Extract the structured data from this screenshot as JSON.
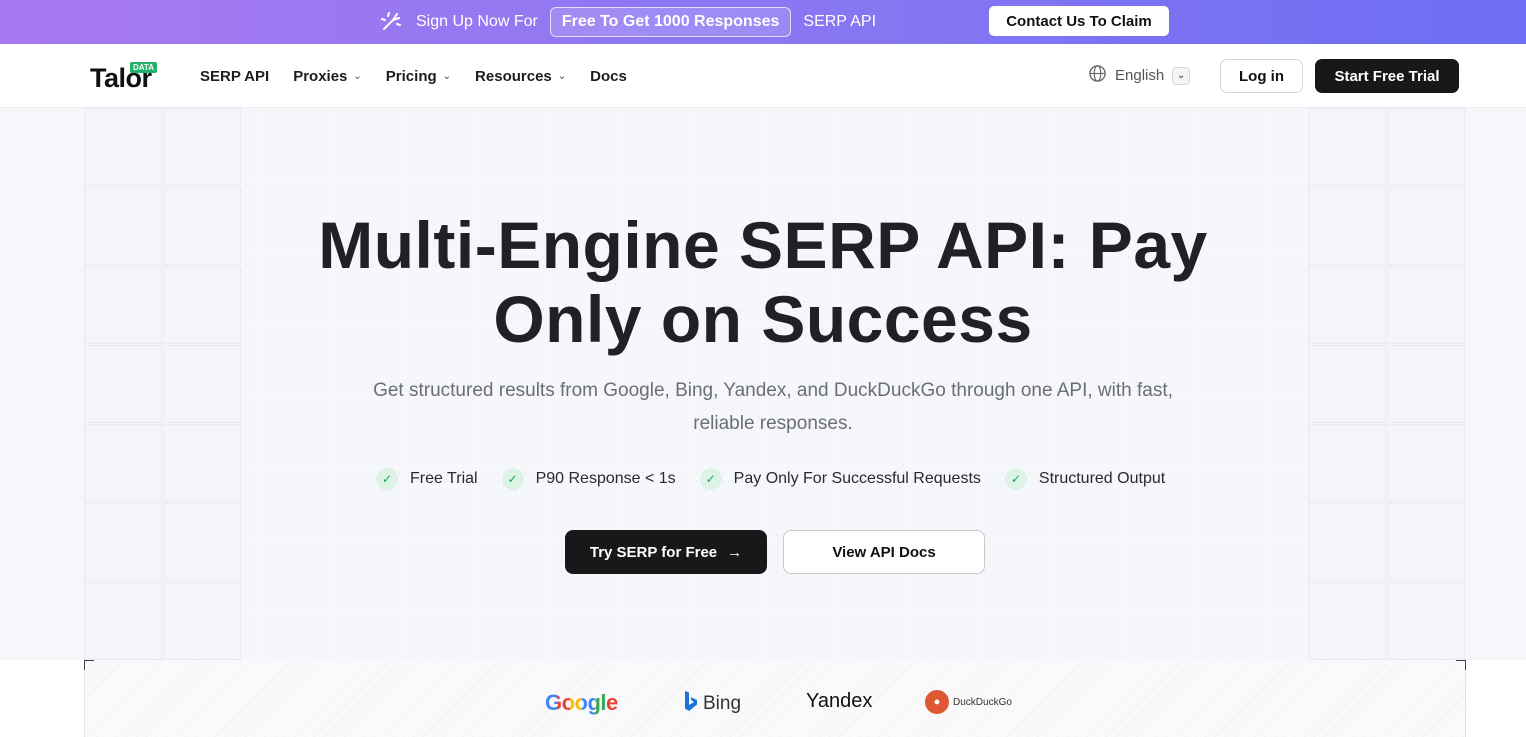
{
  "promo": {
    "lead": "Sign Up Now For",
    "pill": "Free To Get 1000 Responses",
    "product": "SERP API",
    "cta": "Contact Us To Claim"
  },
  "nav": {
    "logo": "Talor",
    "logo_badge": "DATA",
    "links": [
      {
        "label": "SERP API"
      },
      {
        "label": "Proxies"
      },
      {
        "label": "Pricing"
      },
      {
        "label": "Resources"
      },
      {
        "label": "Docs"
      }
    ],
    "language": "English",
    "login": "Log in",
    "start_trial": "Start Free Trial"
  },
  "hero": {
    "title_line1": "Multi-Engine SERP API: Pay",
    "title_line2": "Only on Success",
    "subtitle_line1": "Get structured results from Google, Bing, Yandex, and DuckDuckGo through one API, with fast,",
    "subtitle_line2": "reliable responses.",
    "features": [
      "Free Trial",
      "P90 Response < 1s",
      "Pay Only For Successful Requests",
      "Structured Output"
    ],
    "primary_cta": "Try SERP for Free",
    "secondary_cta": "View API Docs"
  },
  "engines": {
    "google": "Google",
    "bing": "Bing",
    "yandex": "Yandex",
    "duckduckgo": "DuckDuckGo"
  },
  "colors": {
    "promo_start": "#a979f0",
    "promo_end": "#6d6ef3",
    "primary_dark": "#18181b",
    "check_green": "#1aa35c",
    "logo_badge_green": "#1fb36a"
  }
}
